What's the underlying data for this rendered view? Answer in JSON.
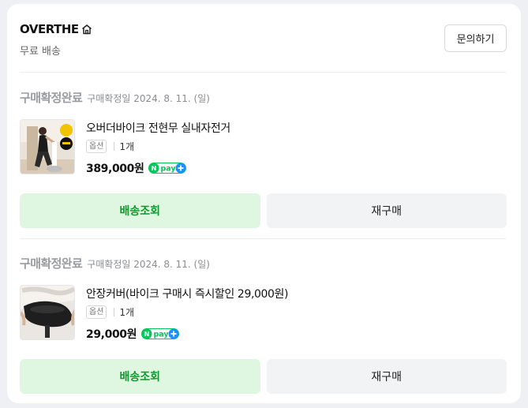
{
  "store": {
    "name": "OVERTHE",
    "shipping_note": "무료 배송",
    "inquiry_label": "문의하기",
    "home_icon": "home-icon"
  },
  "orders": [
    {
      "status": "구매확정완료",
      "confirm_date": "구매확정일 2024. 8. 11. (일)",
      "product_name": "오버더바이크 전현무 실내자전거",
      "option_label": "옵션",
      "quantity": "1개",
      "price": "389,000원",
      "pay_badge": "pay",
      "track_label": "배송조회",
      "reorder_label": "재구매"
    },
    {
      "status": "구매확정완료",
      "confirm_date": "구매확정일 2024. 8. 11. (일)",
      "product_name": "안장커버(바이크 구매시 즉시할인 29,000원)",
      "option_label": "옵션",
      "quantity": "1개",
      "price": "29,000원",
      "pay_badge": "pay",
      "track_label": "배송조회",
      "reorder_label": "재구매"
    }
  ],
  "colors": {
    "accent_green": "#0c9a2c",
    "track_bg": "#dff6e1",
    "status_gray": "#9a9ca0",
    "npay_green": "#03c75a",
    "npay_blue": "#1e90ff"
  }
}
